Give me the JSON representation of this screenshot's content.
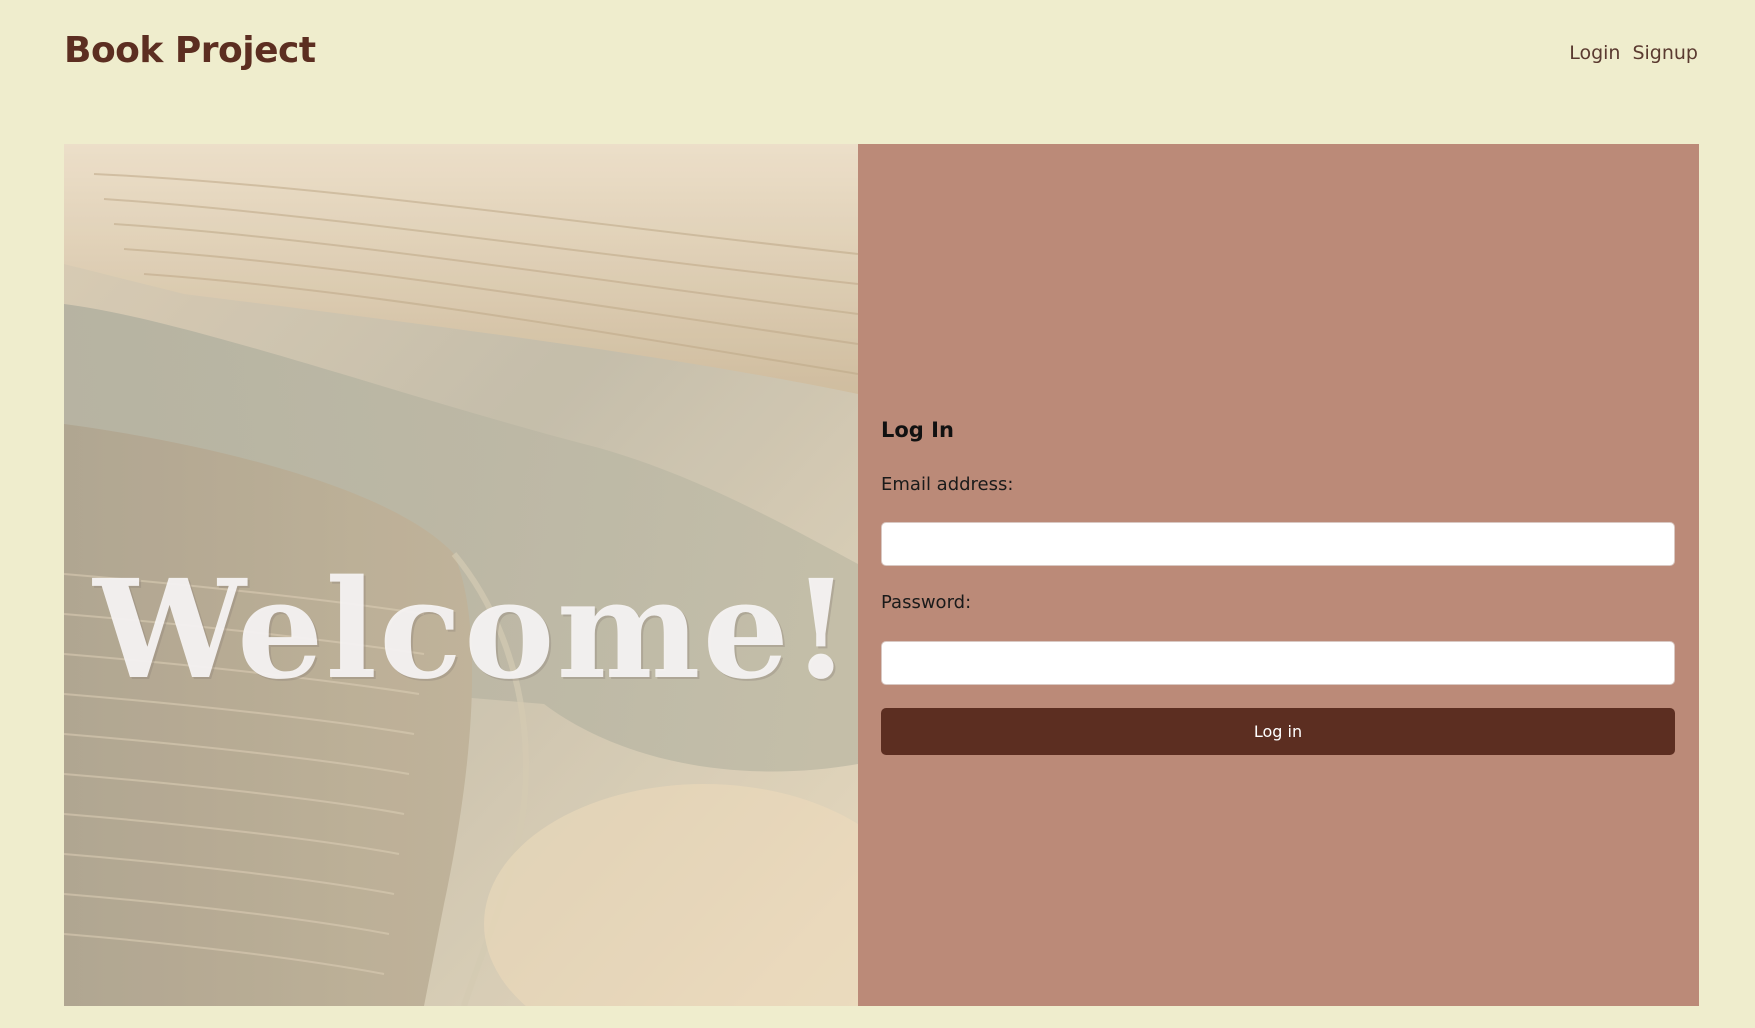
{
  "header": {
    "brand": "Book Project",
    "nav": {
      "login": "Login",
      "signup": "Signup"
    }
  },
  "hero": {
    "headline": "Welcome!",
    "image_icon": "open-book-photo"
  },
  "login_form": {
    "title": "Log In",
    "email_label": "Email address:",
    "email_value": "",
    "password_label": "Password:",
    "password_value": "",
    "submit_label": "Log in"
  },
  "colors": {
    "page_background": "#efedcd",
    "brand": "#5c2e21",
    "panel": "#bb8a78",
    "button": "#5c2e21",
    "input": "#ffffff"
  }
}
